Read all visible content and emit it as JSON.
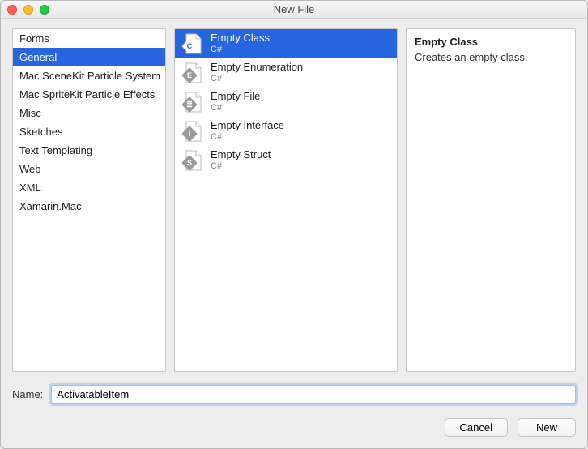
{
  "window": {
    "title": "New File"
  },
  "categories": [
    {
      "label": "Forms",
      "selected": false
    },
    {
      "label": "General",
      "selected": true
    },
    {
      "label": "Mac SceneKit Particle System",
      "selected": false
    },
    {
      "label": "Mac SpriteKit Particle Effects",
      "selected": false
    },
    {
      "label": "Misc",
      "selected": false
    },
    {
      "label": "Sketches",
      "selected": false
    },
    {
      "label": "Text Templating",
      "selected": false
    },
    {
      "label": "Web",
      "selected": false
    },
    {
      "label": "XML",
      "selected": false
    },
    {
      "label": "Xamarin.Mac",
      "selected": false
    }
  ],
  "templates": [
    {
      "name": "Empty Class",
      "sub": "C#",
      "glyph": "C",
      "selected": true
    },
    {
      "name": "Empty Enumeration",
      "sub": "C#",
      "glyph": "E",
      "selected": false
    },
    {
      "name": "Empty File",
      "sub": "C#",
      "glyph": "≣",
      "selected": false
    },
    {
      "name": "Empty Interface",
      "sub": "C#",
      "glyph": "I",
      "selected": false
    },
    {
      "name": "Empty Struct",
      "sub": "C#",
      "glyph": "S",
      "selected": false
    }
  ],
  "description": {
    "title": "Empty Class",
    "text": "Creates an empty class."
  },
  "name_field": {
    "label": "Name:",
    "value": "ActivatableItem"
  },
  "buttons": {
    "cancel": "Cancel",
    "new": "New"
  }
}
